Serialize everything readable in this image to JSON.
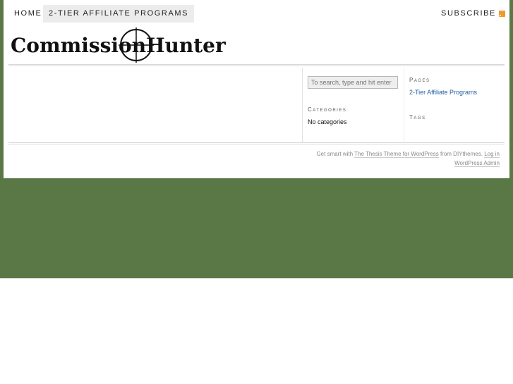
{
  "nav": {
    "home": "HOME",
    "affiliate": "2-TIER AFFILIATE PROGRAMS",
    "subscribe": "SUBSCRIBE"
  },
  "logo": {
    "left": "Commission",
    "right": "Hunter"
  },
  "search": {
    "placeholder": "To search, type and hit enter"
  },
  "sidebar1": {
    "categories_title": "Categories",
    "categories_empty": "No categories"
  },
  "sidebar2": {
    "pages_title": "Pages",
    "pages_link": "2-Tier Affiliate Programs",
    "tags_title": "Tags"
  },
  "footer": {
    "prefix": "Get smart with",
    "thesis_link": "The Thesis Theme for WordPress",
    "from_text": "from DIYthemes.",
    "login_link": "Log in",
    "admin_link": "WordPress Admin"
  },
  "colors": {
    "background": "#5a7746",
    "link": "#2361a1",
    "rss": "#f09a2b"
  }
}
